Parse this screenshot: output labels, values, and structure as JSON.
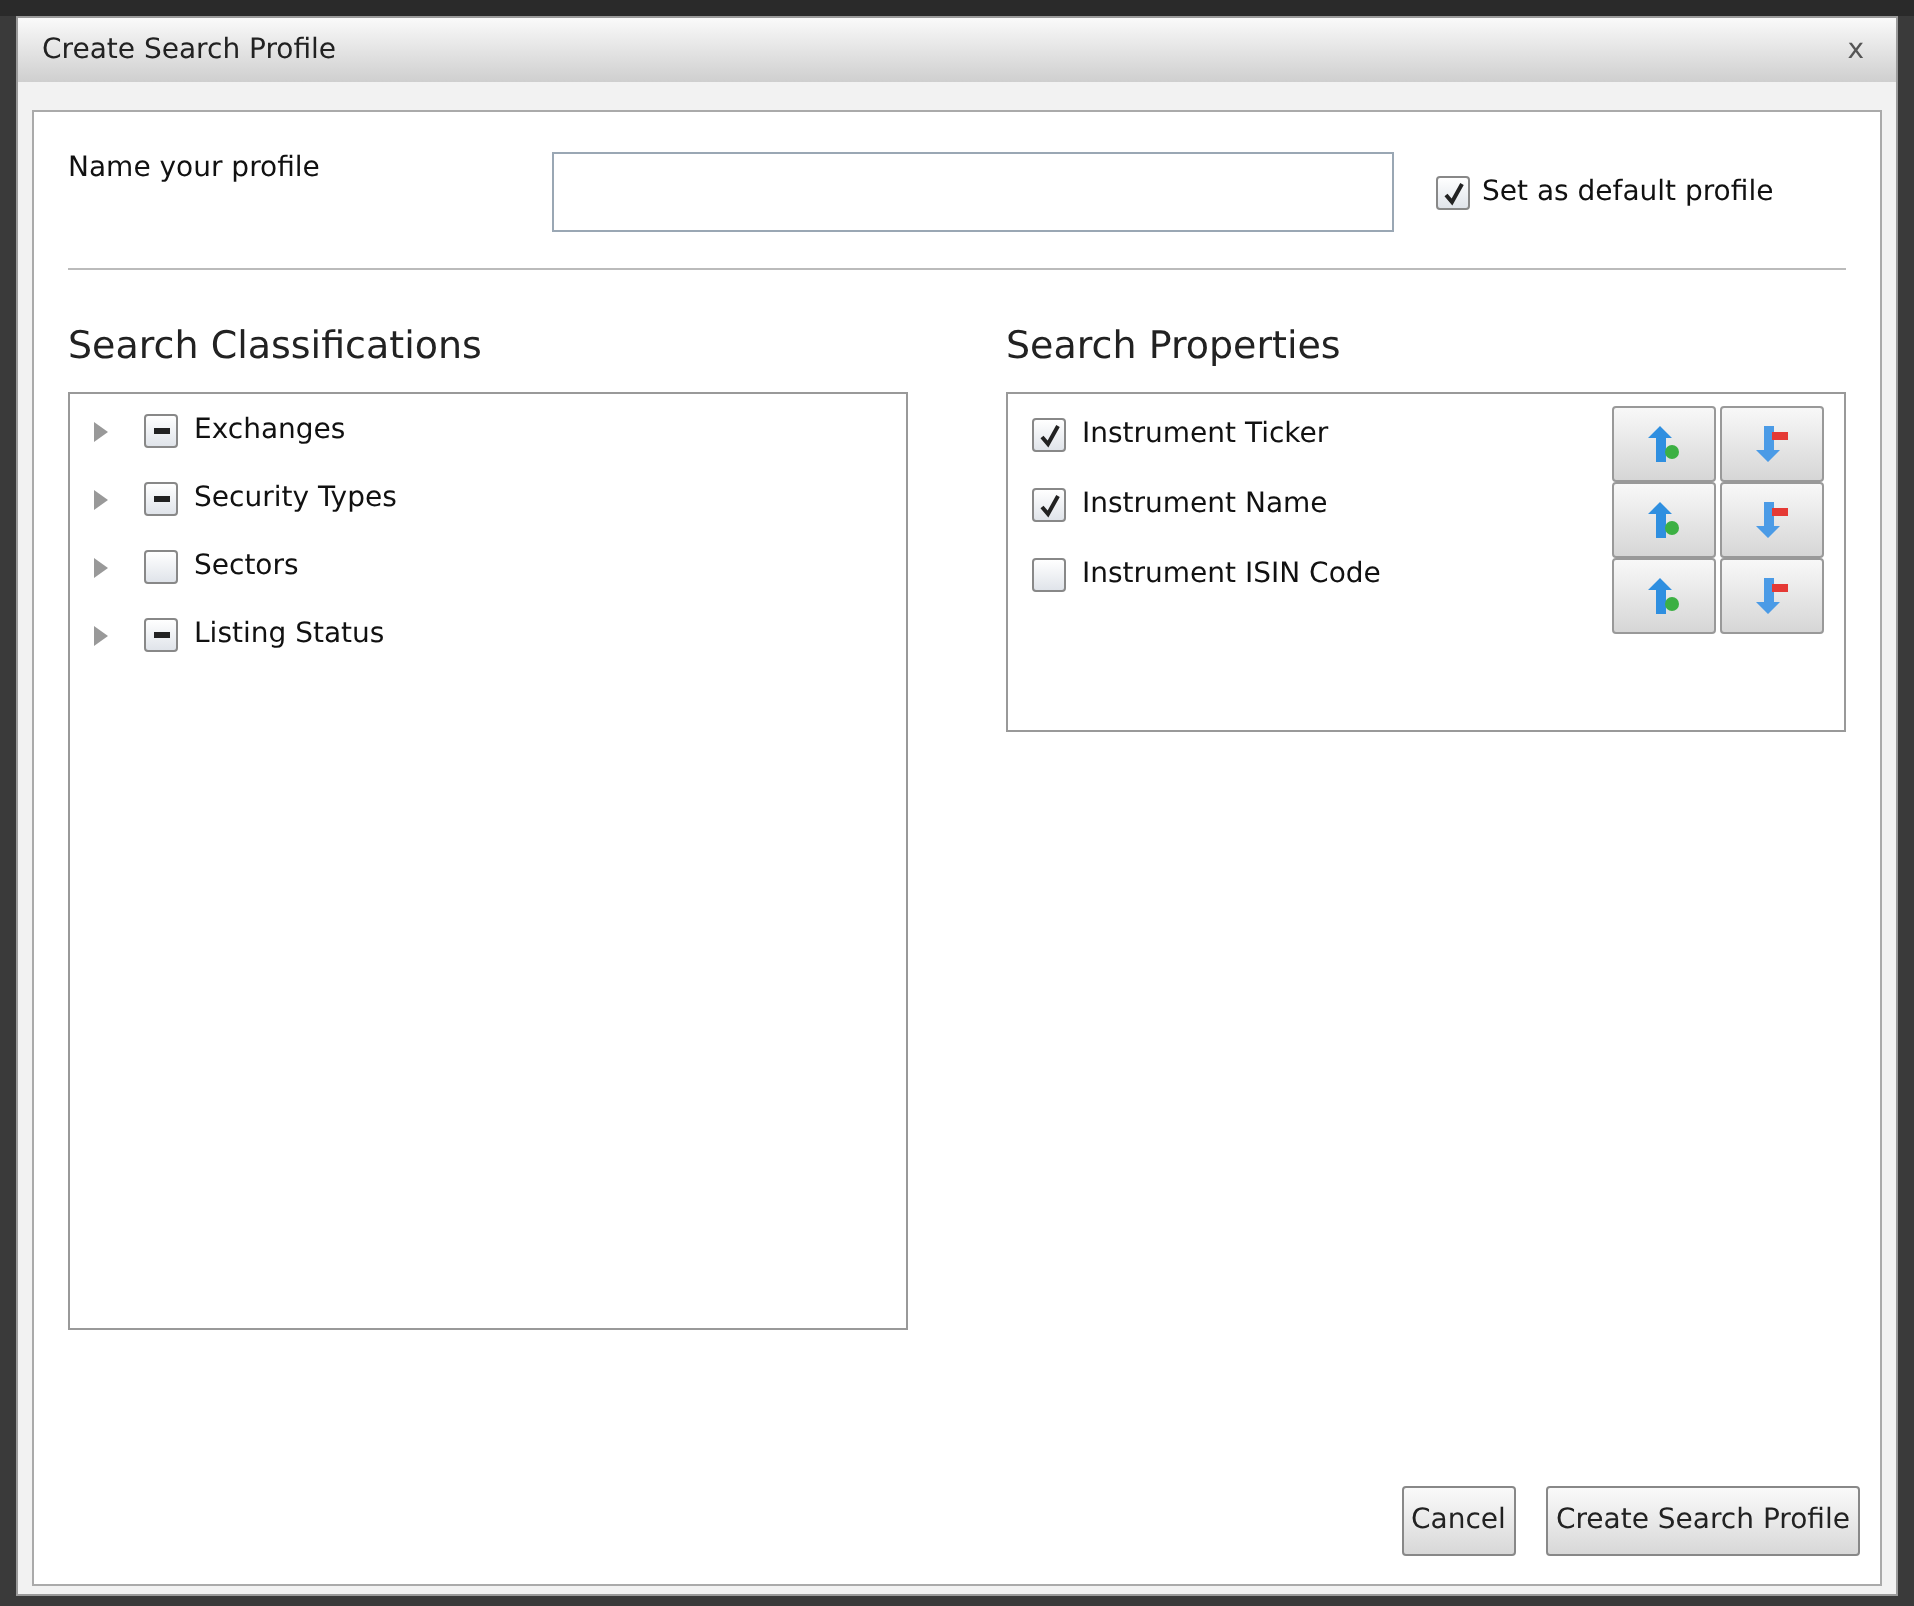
{
  "dialog": {
    "title": "Create Search Profile",
    "close": "x"
  },
  "profile_name": {
    "label": "Name your profile"
  },
  "default_profile": {
    "label": "Set as default profile",
    "checked": true
  },
  "classifications": {
    "heading": "Search Classifications",
    "items": [
      {
        "label": "Exchanges",
        "expanded": false,
        "partial": true
      },
      {
        "label": "Security Types",
        "expanded": false,
        "partial": true
      },
      {
        "label": "Sectors",
        "expanded": false,
        "partial": false
      },
      {
        "label": "Listing Status",
        "expanded": false,
        "partial": true
      }
    ]
  },
  "properties": {
    "heading": "Search Properties",
    "items": [
      {
        "label": "Instrument Ticker",
        "checked": true
      },
      {
        "label": "Instrument Name",
        "checked": true
      },
      {
        "label": "Instrument ISIN Code",
        "checked": false
      }
    ]
  },
  "buttons": [
    {
      "label": "Cancel"
    },
    {
      "label": "Create Search Profile"
    }
  ]
}
